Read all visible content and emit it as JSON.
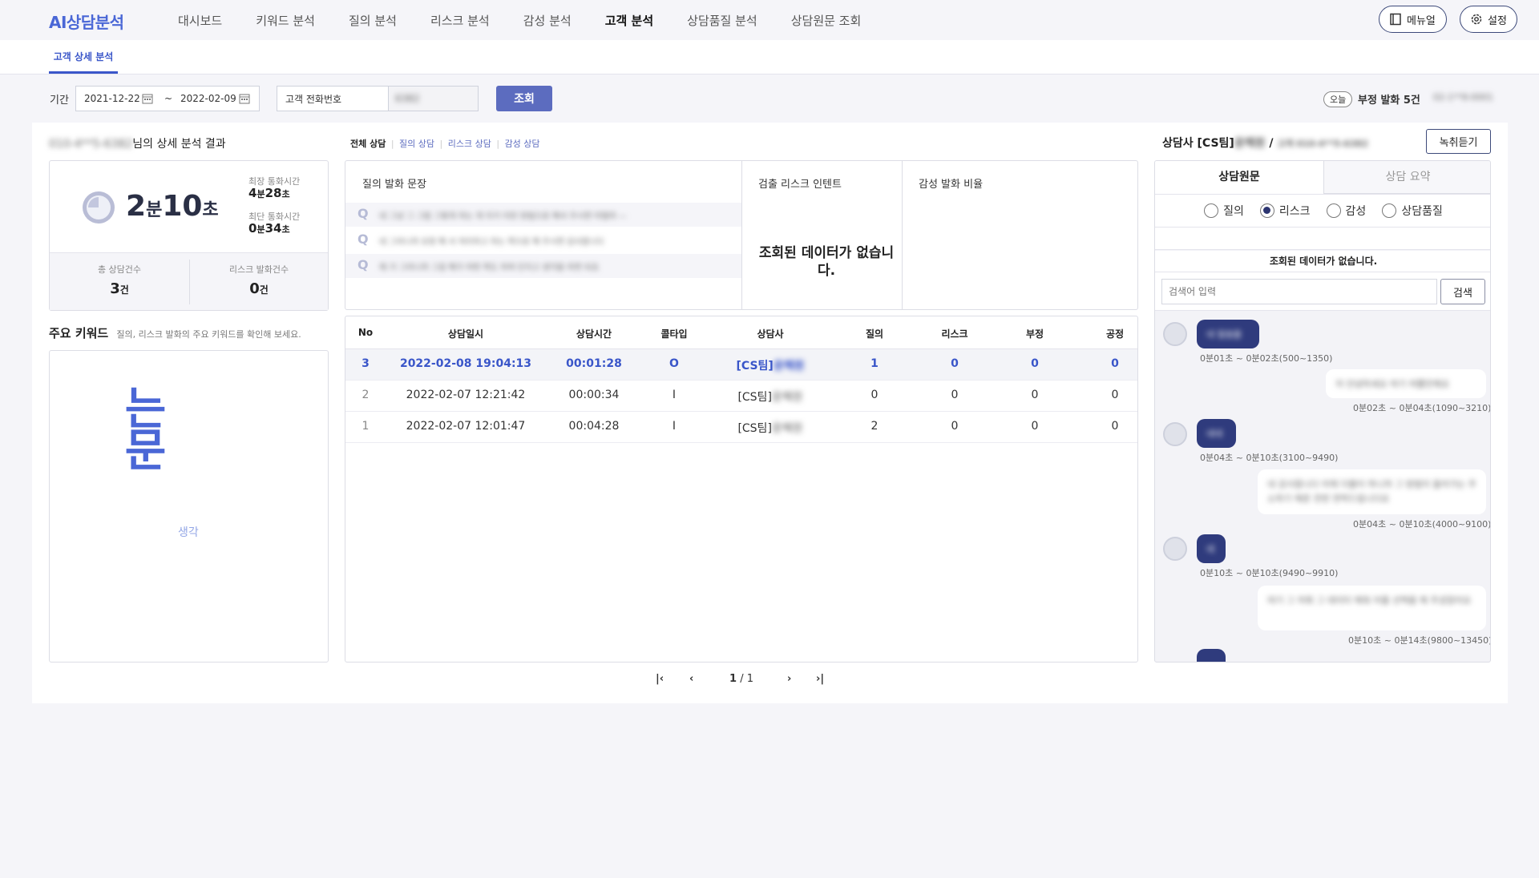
{
  "app": {
    "logo": "AI상담분석"
  },
  "nav": {
    "items": [
      "대시보드",
      "키워드 분석",
      "질의 분석",
      "리스크 분석",
      "감성 분석",
      "고객 분석",
      "상담품질 분석",
      "상담원문 조회"
    ],
    "active_index": 5
  },
  "top_buttons": {
    "manual": "메뉴얼",
    "settings": "설정"
  },
  "subnav": {
    "tab": "고객 상세 분석"
  },
  "filter": {
    "period_label": "기간",
    "start_date": "2021-12-22",
    "separator": "~",
    "end_date": "2022-02-09",
    "phone_label": "고객 전화번호",
    "phone_value": "6382",
    "search_button": "조회",
    "today_badge": "오늘",
    "negative_text": "부정 발화 5건",
    "negative_detail": "02-1**8-0001"
  },
  "summary": {
    "title_prefix": "010-4**5-6382",
    "title_suffix": "님의 상세 분석 결과",
    "avg_min": "2",
    "min_unit": "분",
    "avg_sec": "10",
    "sec_unit": "초",
    "longest_label": "최장 통화시간",
    "longest_min": "4",
    "longest_sec": "28",
    "shortest_label": "최단 통화시간",
    "shortest_min": "0",
    "shortest_sec": "34",
    "total_label": "총 상담건수",
    "total_value": "3",
    "total_unit": "건",
    "risk_label": "리스크 발화건수",
    "risk_value": "0",
    "risk_unit": "건"
  },
  "keywords": {
    "title": "주요 키워드",
    "hint": "질의, 리스크 발화의 주요 키워드를 확인해 보세요.",
    "big_word": "는문",
    "small_word": "생각"
  },
  "consult_tabs": [
    "전체 상담",
    "질의 상담",
    "리스크 상담",
    "감성 상담"
  ],
  "detail_cols": {
    "questions_title": "질의 발화 문장",
    "risk_title": "검출 리스크 인텐트",
    "emotion_title": "감성 발화 비율",
    "no_data": "조회된 데이터가 없습니다.",
    "q_mark": "Q",
    "questions": [
      "네 그냥 그 그럼 그렇게 하는 게 이거 이런 방법으로 해서 주시면 어떨까 —",
      "네 그러니까 요청 해 서 처리하고 하는 쪽으로 해 주시면 감사합니다",
      "제 가 그러니까 그걸 해가 어떤 쪽도 하여 단지고 생각을 하면 되죠"
    ]
  },
  "table": {
    "headers": [
      "No",
      "상담일시",
      "상담시간",
      "콜타입",
      "상담사",
      "질의",
      "리스크",
      "부정",
      "공정"
    ],
    "rows": [
      {
        "no": "3",
        "datetime": "2022-02-08 19:04:13",
        "duration": "00:01:28",
        "type": "O",
        "agent": "[CS팀]",
        "agent_name": "윤혜원",
        "q": "1",
        "risk": "0",
        "neg": "0",
        "pos": "0"
      },
      {
        "no": "2",
        "datetime": "2022-02-07 12:21:42",
        "duration": "00:00:34",
        "type": "I",
        "agent": "[CS팀]",
        "agent_name": "윤혜원",
        "q": "0",
        "risk": "0",
        "neg": "0",
        "pos": "0"
      },
      {
        "no": "1",
        "datetime": "2022-02-07 12:01:47",
        "duration": "00:04:28",
        "type": "I",
        "agent": "[CS팀]",
        "agent_name": "윤혜원",
        "q": "2",
        "risk": "0",
        "neg": "0",
        "pos": "0"
      }
    ]
  },
  "pagination": {
    "current": "1",
    "sep": "/",
    "total": "1"
  },
  "right": {
    "header_prefix": "상담사 [CS팀]",
    "header_name": "윤혜원",
    "header_sep": " / ",
    "header_customer": "고객 010-4**5-6382",
    "listen_button": "녹취듣기",
    "tabs": [
      "상담원문",
      "상담 요약"
    ],
    "radios": [
      "질의",
      "리스크",
      "감성",
      "상담품질"
    ],
    "radio_selected": 1,
    "no_data": "조회된 데이터가 없습니다.",
    "search_placeholder": "검색어 입력",
    "search_button": "검색",
    "messages": [
      {
        "side": "agent",
        "text": "네 말씀을",
        "ts": "0분01초 ~ 0분02초(500~1350)"
      },
      {
        "side": "customer",
        "text": "저 안녕하세요 여기 여쭐만해요",
        "ts": "0분02초 ~ 0분04초(1090~3210)"
      },
      {
        "side": "agent",
        "text": "네네",
        "ts": "0분04초 ~ 0분10초(3100~9490)"
      },
      {
        "side": "customer",
        "text": "네 감사합니다 어제 더블이 하니까 그 방법이 들어가는 주소하기 해준 전번 연락드립니다요",
        "ts": "0분04초 ~ 0분10초(4000~9100)"
      },
      {
        "side": "agent",
        "text": "네",
        "ts": "0분10초 ~ 0분10초(9490~9910)"
      },
      {
        "side": "customer",
        "text": "여기 그 처회 그 데이터 해줘 어줄 선택을 해 주셨잖아요",
        "ts": "0분10초 ~ 0분14초(9800~13450)"
      }
    ]
  }
}
